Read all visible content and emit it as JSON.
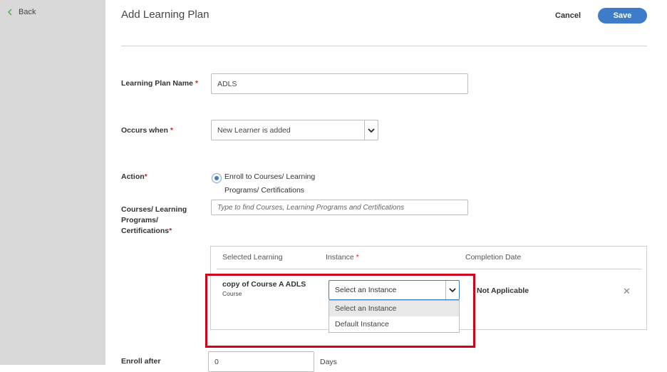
{
  "sidebar": {
    "back_label": "Back"
  },
  "header": {
    "title": "Add Learning Plan",
    "cancel_label": "Cancel",
    "save_label": "Save"
  },
  "form": {
    "plan_name": {
      "label": "Learning Plan Name",
      "required": "*",
      "value": "ADLS"
    },
    "occurs_when": {
      "label": "Occurs when",
      "required": "*",
      "value": "New Learner is added"
    },
    "action": {
      "label": "Action",
      "required": "*",
      "option_label": "Enroll to Courses/ Learning Programs/ Certifications"
    },
    "courses": {
      "label": "Courses/ Learning Programs/ Certifications",
      "required": "*",
      "placeholder": "Type to find Courses, Learning Programs and Certifications"
    },
    "enroll_after": {
      "label": "Enroll after",
      "value": "0",
      "unit": "Days"
    }
  },
  "selection_table": {
    "headers": {
      "selected_learning": "Selected Learning",
      "instance": "Instance",
      "instance_required": "*",
      "completion_date": "Completion Date"
    },
    "row": {
      "name": "copy of Course A ADLS",
      "type": "Course",
      "instance_value": "Select an Instance",
      "completion": "Not Applicable"
    },
    "instance_options": [
      "Select an Instance",
      "Default Instance"
    ]
  },
  "colors": {
    "accent": "#3d7cc9",
    "required": "#c62828",
    "highlight_box": "#d0021b",
    "sidebar": "#d9d9d9"
  }
}
